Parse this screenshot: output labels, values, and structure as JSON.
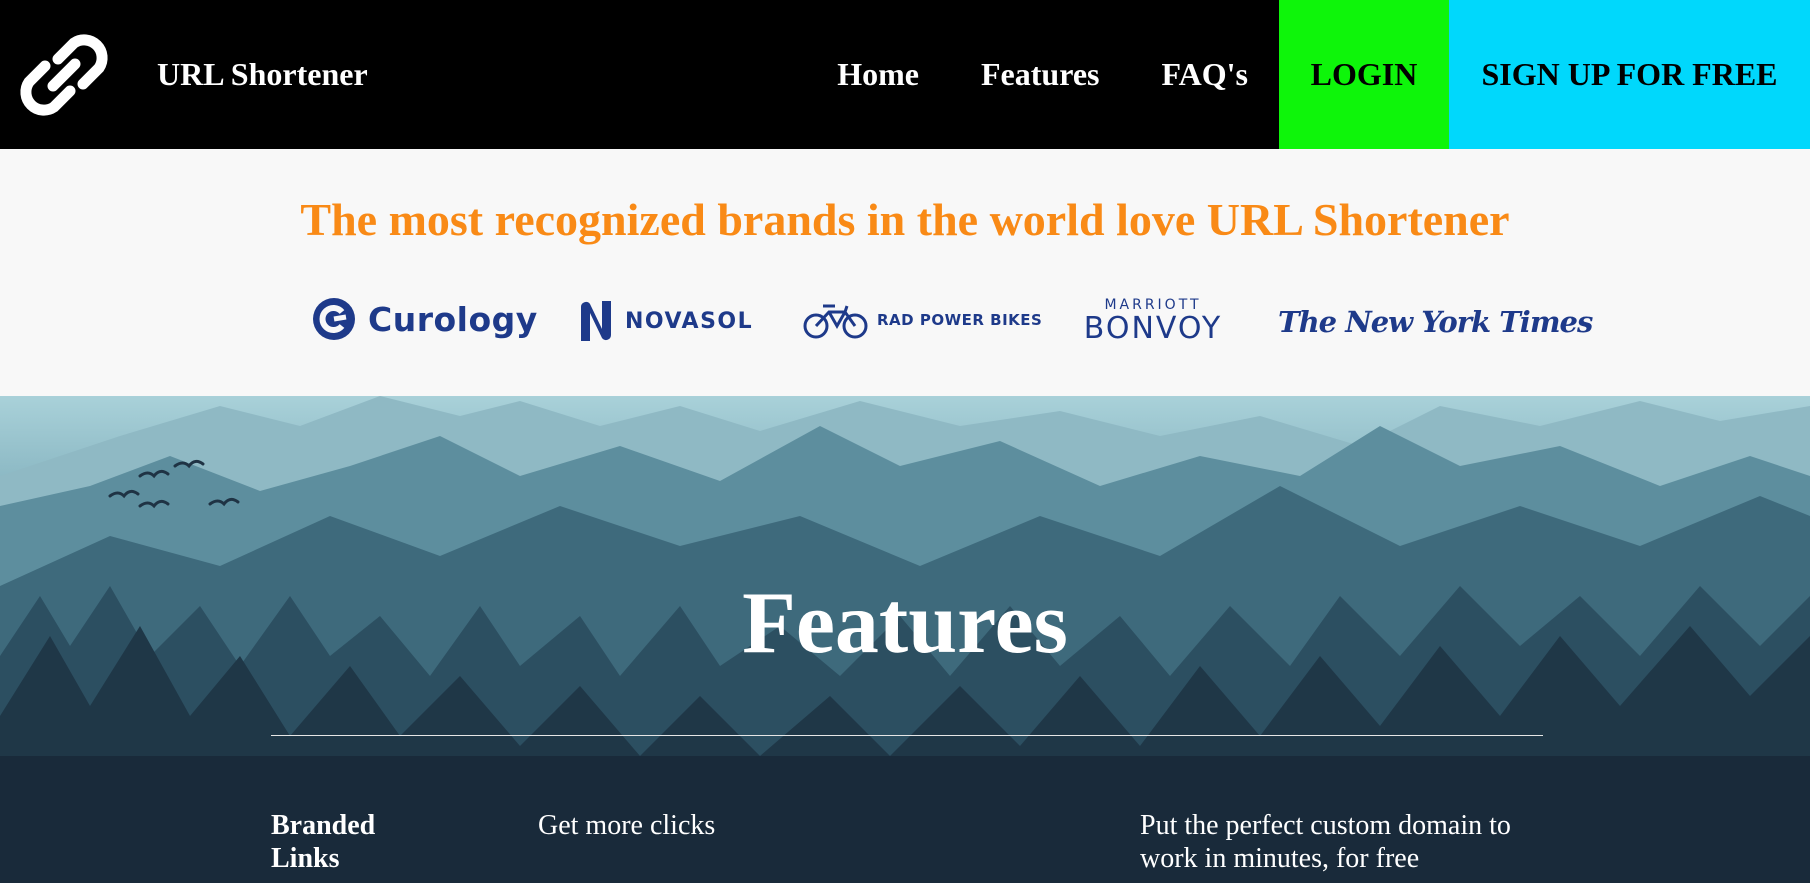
{
  "nav": {
    "brand": "URL Shortener",
    "links": {
      "home": "Home",
      "features": "Features",
      "faqs": "FAQ's"
    },
    "login": "LOGIN",
    "signup": "SIGN UP FOR FREE"
  },
  "brands": {
    "title": "The most recognized brands in the world love URL Shortener",
    "logos": {
      "curology": "Curology",
      "novasol": "NOVASOL",
      "radpower": "RAD POWER BIKES",
      "marriott_top": "MARRIOTT",
      "marriott_bottom": "BONVOY",
      "nyt": "The New York Times"
    }
  },
  "features": {
    "title": "Features",
    "item": {
      "label": "Branded Links",
      "description": "Get more clicks",
      "detail": "Put the perfect custom domain to work in minutes, for free"
    }
  },
  "colors": {
    "nav_bg": "#000000",
    "login_bg": "#0ef50a",
    "signup_bg": "#00d8fc",
    "brands_title": "#f98a16",
    "logo_blue": "#1e3a8a"
  }
}
